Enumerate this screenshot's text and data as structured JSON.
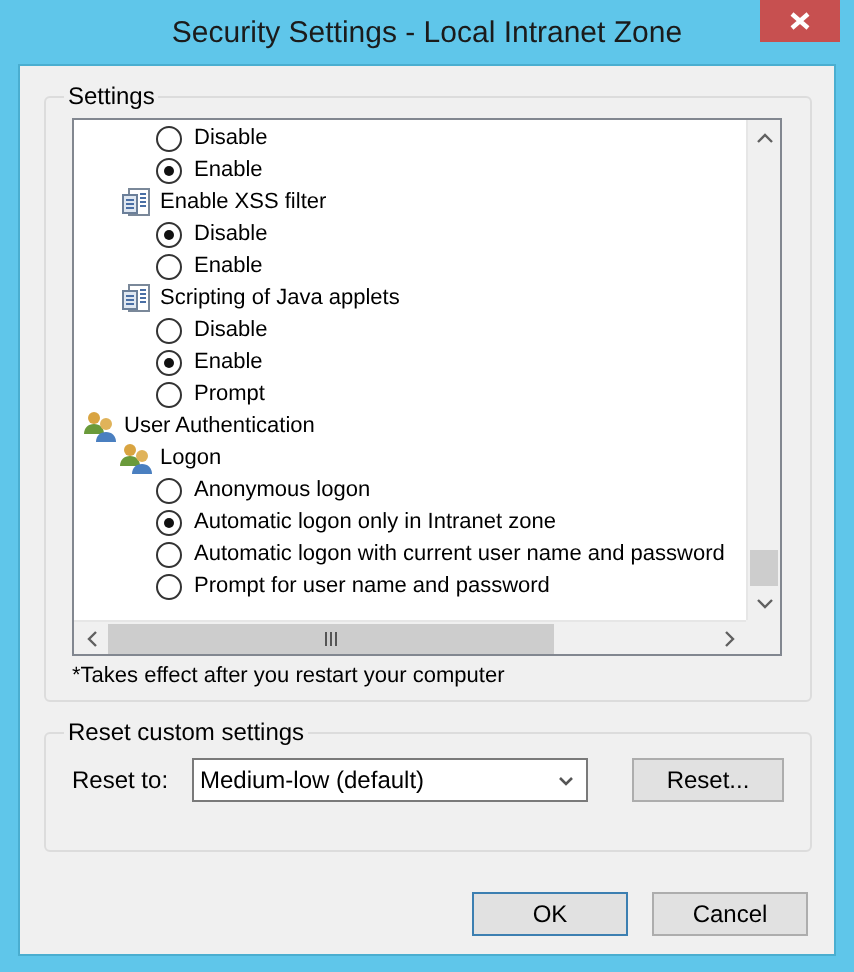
{
  "window": {
    "title": "Security Settings - Local Intranet Zone"
  },
  "settings_group": {
    "label": "Settings",
    "tree": [
      {
        "kind": "continued",
        "children": [
          {
            "kind": "continued",
            "children": [
              {
                "kind": "radio",
                "label": "Disable",
                "selected": false
              },
              {
                "kind": "radio",
                "label": "Enable",
                "selected": true
              }
            ]
          },
          {
            "kind": "setting",
            "label": "Enable XSS filter",
            "children": [
              {
                "kind": "radio",
                "label": "Disable",
                "selected": true
              },
              {
                "kind": "radio",
                "label": "Enable",
                "selected": false
              }
            ]
          },
          {
            "kind": "setting",
            "label": "Scripting of Java applets",
            "children": [
              {
                "kind": "radio",
                "label": "Disable",
                "selected": false
              },
              {
                "kind": "radio",
                "label": "Enable",
                "selected": true
              },
              {
                "kind": "radio",
                "label": "Prompt",
                "selected": false
              }
            ]
          }
        ]
      },
      {
        "kind": "group",
        "label": "User Authentication",
        "children": [
          {
            "kind": "group",
            "label": "Logon",
            "children": [
              {
                "kind": "radio",
                "label": "Anonymous logon",
                "selected": false
              },
              {
                "kind": "radio",
                "label": "Automatic logon only in Intranet zone",
                "selected": true
              },
              {
                "kind": "radio",
                "label": "Automatic logon with current user name and password",
                "selected": false
              },
              {
                "kind": "radio",
                "label": "Prompt for user name and password",
                "selected": false
              }
            ]
          }
        ]
      }
    ],
    "note": "*Takes effect after you restart your computer"
  },
  "reset_group": {
    "label": "Reset custom settings",
    "field_label": "Reset to:",
    "value": "Medium-low (default)",
    "button": "Reset..."
  },
  "buttons": [
    "OK",
    "Cancel"
  ]
}
